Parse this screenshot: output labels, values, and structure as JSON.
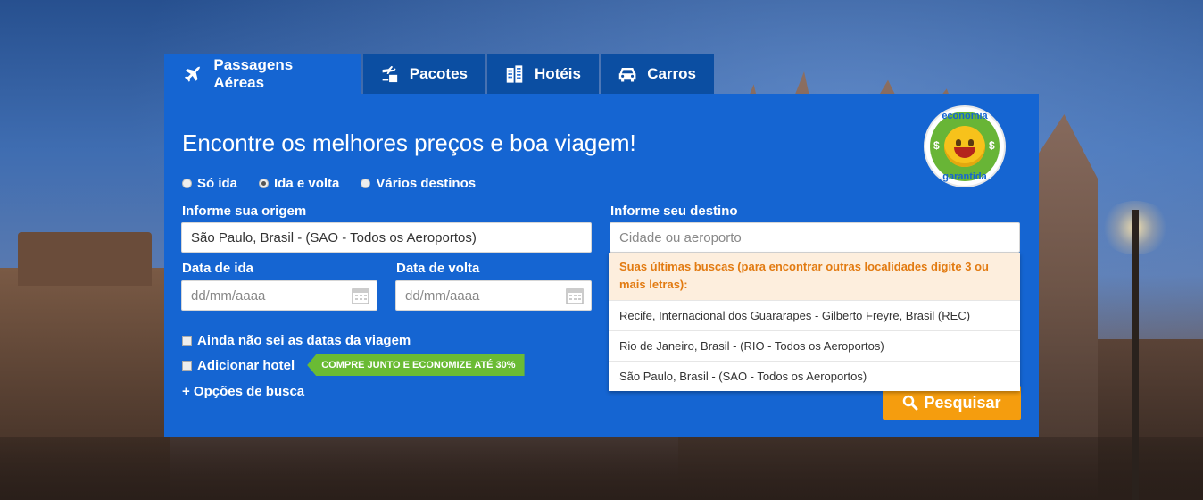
{
  "tabs": [
    {
      "label": "Passagens Aéreas",
      "icon": "airplane-icon",
      "active": true
    },
    {
      "label": "Pacotes",
      "icon": "package-icon",
      "active": false
    },
    {
      "label": "Hotéis",
      "icon": "hotel-icon",
      "active": false
    },
    {
      "label": "Carros",
      "icon": "car-icon",
      "active": false
    }
  ],
  "panel": {
    "headline": "Encontre os melhores preços e boa viagem!",
    "badge": {
      "top_text": "economia",
      "bottom_text": "garantida",
      "symbol": "$"
    },
    "trip_types": [
      {
        "label": "Só ida",
        "selected": false
      },
      {
        "label": "Ida e volta",
        "selected": true
      },
      {
        "label": "Vários destinos",
        "selected": false
      }
    ],
    "origin": {
      "label": "Informe sua origem",
      "value": "São Paulo, Brasil - (SAO - Todos os Aeroportos)"
    },
    "destination": {
      "label": "Informe seu destino",
      "placeholder": "Cidade ou aeroporto",
      "value": ""
    },
    "depart": {
      "label": "Data de ida",
      "placeholder": "dd/mm/aaaa"
    },
    "return": {
      "label": "Data de volta",
      "placeholder": "dd/mm/aaaa"
    },
    "no_dates_label": "Ainda não sei as datas da viagem",
    "add_hotel_label": "Adicionar hotel",
    "promo_text": "COMPRE JUNTO E ECONOMIZE ATÉ 30%",
    "options_label": "+ Opções de busca",
    "search_label": "Pesquisar"
  },
  "dropdown": {
    "header": "Suas últimas buscas (para encontrar outras localidades digite 3 ou mais letras):",
    "items": [
      "Recife, Internacional dos Guararapes - Gilberto Freyre, Brasil (REC)",
      "Rio de Janeiro, Brasil - (RIO - Todos os Aeroportos)",
      "São Paulo, Brasil - (SAO - Todos os Aeroportos)"
    ]
  },
  "colors": {
    "panel": "#1565d2",
    "tab_inactive": "#0b4ea2",
    "search": "#f59d0e",
    "promo": "#6abb34",
    "dropdown_header": "#e27b12"
  }
}
